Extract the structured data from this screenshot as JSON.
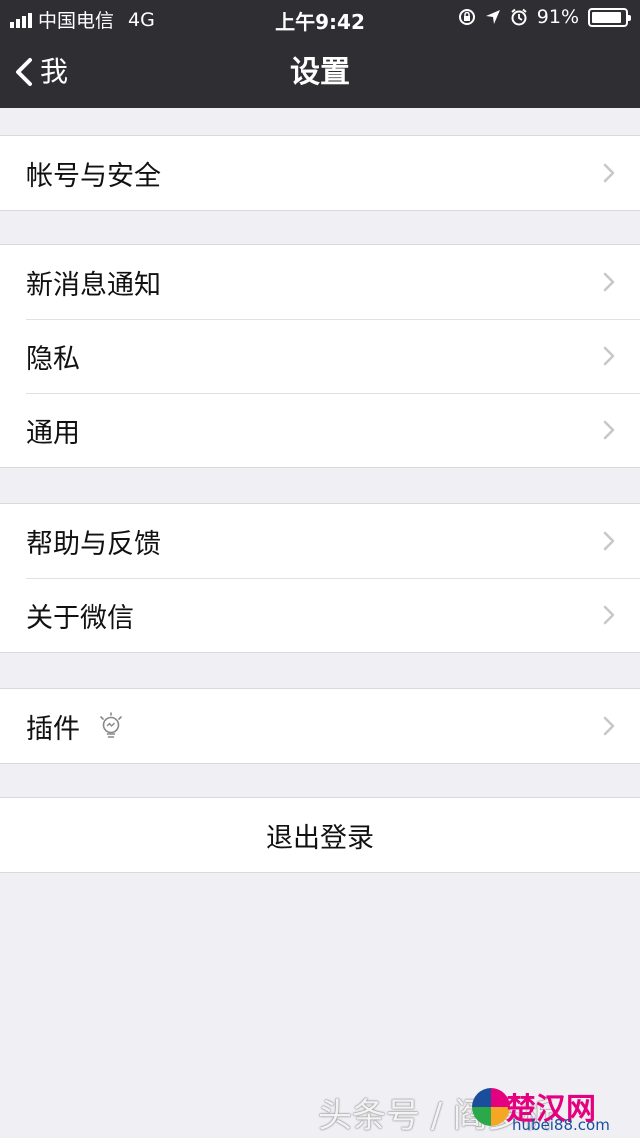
{
  "status_bar": {
    "carrier": "中国电信",
    "network": "4G",
    "time": "上午9:42",
    "battery_percent": "91%",
    "battery_level": 0.91,
    "icons": [
      "orientation-lock-icon",
      "location-arrow-icon",
      "alarm-icon"
    ]
  },
  "navbar": {
    "back_label": "我",
    "title": "设置"
  },
  "groups": [
    {
      "items": [
        {
          "label": "帐号与安全"
        }
      ]
    },
    {
      "items": [
        {
          "label": "新消息通知"
        },
        {
          "label": "隐私"
        },
        {
          "label": "通用"
        }
      ]
    },
    {
      "items": [
        {
          "label": "帮助与反馈"
        },
        {
          "label": "关于微信"
        }
      ]
    },
    {
      "items": [
        {
          "label": "插件",
          "icon": "lightbulb-icon"
        }
      ]
    }
  ],
  "logout": {
    "label": "退出登录"
  },
  "watermark": {
    "text": "头条号 / 阎多析",
    "brand": "楚汉网",
    "domain": "hubei88.com"
  },
  "colors": {
    "bar_background": "#2e2e33",
    "page_background": "#efeff4",
    "chevron": "#c7c7cc"
  }
}
